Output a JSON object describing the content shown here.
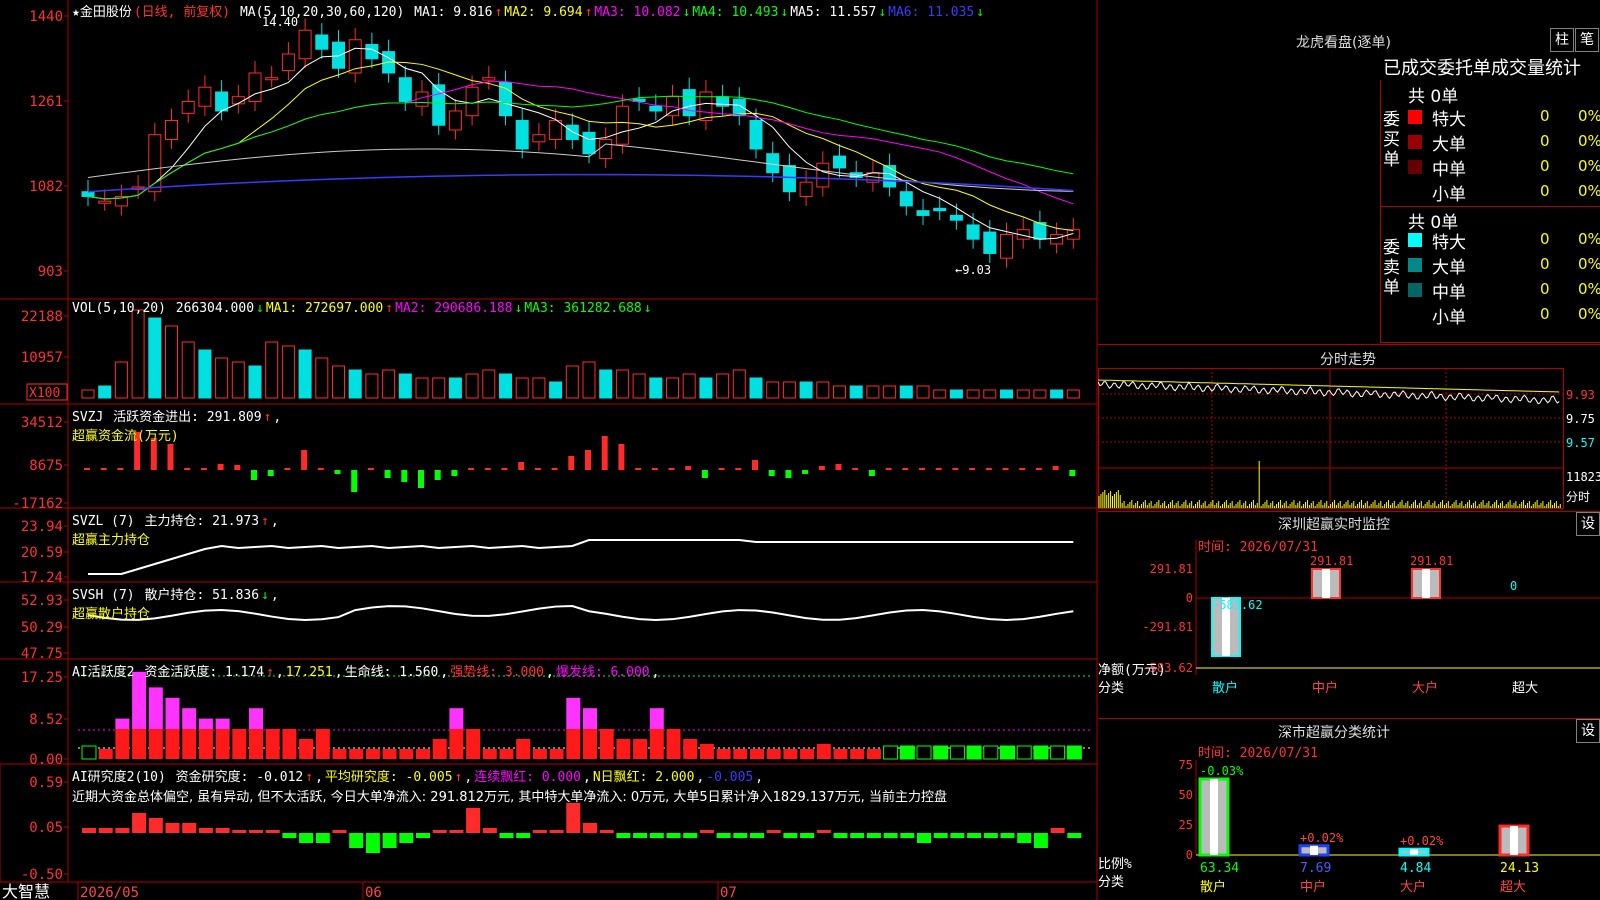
{
  "colors": {
    "up": "#ff2a2a",
    "down": "#00e0e0",
    "green": "#00ff00",
    "magenta": "#ff00ff",
    "yellow": "#ffff00",
    "white": "#ffffff",
    "blue": "#3a3aff",
    "grid": "#b00000"
  },
  "stock": {
    "name": "★金田股份",
    "mode": "(日线, 前复权)"
  },
  "price_panel": {
    "indicator": "MA(5,10,20,30,60,120)",
    "ma": [
      {
        "label": "MA1: 9.816",
        "arrow": "↑",
        "color": "#ffffff"
      },
      {
        "label": "MA2: 9.694",
        "arrow": "↑",
        "color": "#ffff00"
      },
      {
        "label": "MA3: 10.082",
        "arrow": "↓",
        "color": "#ff00ff"
      },
      {
        "label": "MA4: 10.493",
        "arrow": "↓",
        "color": "#00ff00"
      },
      {
        "label": "MA5: 11.557",
        "arrow": "↓",
        "color": "#ffffff"
      },
      {
        "label": "MA6: 11.035",
        "arrow": "↓",
        "color": "#3a3aff"
      }
    ],
    "yticks": [
      "1440",
      "1261",
      "1082",
      "903"
    ],
    "high_label": "14.40",
    "low_label": "←9.03"
  },
  "vol_panel": {
    "indicator": "VOL(5,10,20)",
    "values": [
      {
        "t": "266304.000",
        "a": "↓",
        "c": "#ffffff"
      },
      {
        "t": "MA1: 272697.000",
        "a": "↑",
        "c": "#ffff00"
      },
      {
        "t": "MA2: 290686.188",
        "a": "↓",
        "c": "#ff00ff"
      },
      {
        "t": "MA3: 361282.688",
        "a": "↓",
        "c": "#00ff00"
      }
    ],
    "yticks": [
      "22188",
      "10957"
    ],
    "unit": "X100"
  },
  "svzj_panel": {
    "indicator": "SVZJ",
    "label": "活跃资金进出: 291.809",
    "arrow": "↑",
    "name": "超赢资金流(万元)",
    "yticks": [
      "34512",
      "8675",
      "-17162"
    ]
  },
  "svzl_panel": {
    "indicator": "SVZL (7)",
    "label": "主力持仓: 21.973",
    "arrow": "↑",
    "name": "超赢主力持仓",
    "yticks": [
      "23.94",
      "20.59",
      "17.24"
    ]
  },
  "svsh_panel": {
    "indicator": "SVSH (7)",
    "label": "散户持仓: 51.836",
    "arrow": "↓",
    "name": "超赢散户持仓",
    "yticks": [
      "52.93",
      "50.29",
      "47.75"
    ]
  },
  "ai1_panel": {
    "indicator": "AI活跃度2",
    "label1": "资金活跃度: 1.174",
    "a1": "↑",
    "label2": "17.251",
    "label3": "生命线: 1.560",
    "label4": "强势线: 3.000",
    "label5": "爆发线: 6.000",
    "yticks": [
      "17.25",
      "8.52",
      "0.00"
    ]
  },
  "ai2_panel": {
    "indicator": "AI研究度2(10)",
    "label1": "资金研究度: -0.012",
    "a1": "↑",
    "label2": "平均研究度: -0.005",
    "a2": "↑",
    "label3": "连续飘红: 0.000",
    "label4": "N日飘红: 2.000",
    "label5": "-0.005",
    "note": "近期大资金总体偏空, 虽有异动, 但不太活跃, 今日大单净流入: 291.812万元, 其中特大单净流入: 0万元, 大单5日累计净入1829.137万元, 当前主力控盘",
    "yticks": [
      "0.59",
      "0.05",
      "-0.50"
    ]
  },
  "xaxis": {
    "labels": [
      "2026/05",
      "06",
      "07"
    ]
  },
  "logo": "大智慧",
  "longhu": {
    "title": "龙虎看盘(逐单)",
    "btn1": "柱",
    "btn2": "笔",
    "subtitle": "已成交委托单成交量统计",
    "buy_title": "委买单",
    "buy_count": "共 0单",
    "buy_rows": [
      {
        "label": "特大",
        "color": "#ff0000",
        "value": "0",
        "pct": "0%"
      },
      {
        "label": "大单",
        "color": "#990000",
        "value": "0",
        "pct": "0%"
      },
      {
        "label": "中单",
        "color": "#660000",
        "value": "0",
        "pct": "0%"
      },
      {
        "label": "小单",
        "color": "",
        "value": "0",
        "pct": "0%"
      }
    ],
    "sell_title": "委卖单",
    "sell_count": "共 0单",
    "sell_rows": [
      {
        "label": "特大",
        "color": "#00ffff",
        "value": "0",
        "pct": "0%"
      },
      {
        "label": "大单",
        "color": "#008888",
        "value": "0",
        "pct": "0%"
      },
      {
        "label": "中单",
        "color": "#006666",
        "value": "0",
        "pct": "0%"
      },
      {
        "label": "小单",
        "color": "",
        "value": "0",
        "pct": "0%"
      }
    ]
  },
  "intraday": {
    "title": "分时走势",
    "yticks": [
      "9.93",
      "9.75",
      "9.57"
    ],
    "vol_tick": "11823",
    "vol_label": "分时"
  },
  "sz_monitor": {
    "title": "深圳超赢实时监控",
    "btn": "设",
    "time": "时间: 2026/07/31",
    "yticks": [
      "291.81",
      "0",
      "-291.81",
      "-583.62"
    ],
    "ylabel": "净额(万元)",
    "xlabel": "分类",
    "bars": [
      {
        "cat": "散户",
        "value": -583.62,
        "label": "-583.62",
        "cat_color": "#00ffff"
      },
      {
        "cat": "中户",
        "value": 291.81,
        "label": "291.81",
        "cat_color": "#ff4444"
      },
      {
        "cat": "大户",
        "value": 291.81,
        "label": "291.81",
        "cat_color": "#ff4444"
      },
      {
        "cat": "超大",
        "value": 0,
        "label": "0",
        "cat_color": "#ffffff"
      }
    ]
  },
  "sz_class": {
    "title": "深市超赢分类统计",
    "btn": "设",
    "time": "时间: 2026/07/31",
    "yticks": [
      "75",
      "50",
      "25",
      "0"
    ],
    "ylabel": "比例%",
    "xlabel": "分类",
    "bars": [
      {
        "cat": "散户",
        "value": 63.34,
        "label": "63.34",
        "delta": "-0.03%",
        "color": "#00ff00",
        "cat_color": "#ffff00",
        "delta_color": "#00ff00",
        "val_color": "#00ff00"
      },
      {
        "cat": "中户",
        "value": 7.69,
        "label": "7.69",
        "delta": "+0.02%",
        "color": "#2040ff",
        "cat_color": "#ff4444",
        "delta_color": "#ff4444",
        "val_color": "#4060ff"
      },
      {
        "cat": "大户",
        "value": 4.84,
        "label": "4.84",
        "delta": "+0.02%",
        "color": "#00ffff",
        "cat_color": "#ff4444",
        "delta_color": "#ff4444",
        "val_color": "#00ffff"
      },
      {
        "cat": "超大",
        "value": 24.13,
        "label": "24.13",
        "delta": "",
        "color": "#ff2a2a",
        "cat_color": "#ff4444",
        "delta_color": "#ff4444",
        "val_color": "#ffff00"
      }
    ]
  }
}
